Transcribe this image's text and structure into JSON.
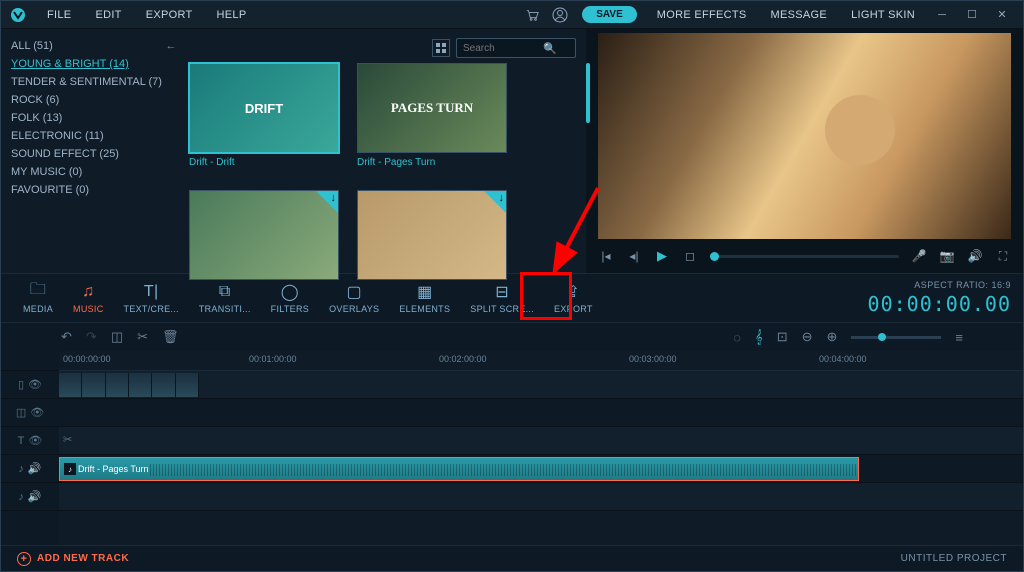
{
  "menubar": {
    "items": [
      "FILE",
      "EDIT",
      "EXPORT",
      "HELP"
    ],
    "save": "SAVE",
    "right_items": [
      "MORE EFFECTS",
      "MESSAGE",
      "LIGHT SKIN"
    ]
  },
  "categories": {
    "items": [
      {
        "label": "ALL (51)",
        "selected": false
      },
      {
        "label": "YOUNG & BRIGHT (14)",
        "selected": true
      },
      {
        "label": "TENDER & SENTIMENTAL (7)",
        "selected": false
      },
      {
        "label": "ROCK (6)",
        "selected": false
      },
      {
        "label": "FOLK (13)",
        "selected": false
      },
      {
        "label": "ELECTRONIC (11)",
        "selected": false
      },
      {
        "label": "SOUND EFFECT (25)",
        "selected": false
      },
      {
        "label": "MY MUSIC (0)",
        "selected": false
      },
      {
        "label": "FAVOURITE (0)",
        "selected": false
      }
    ]
  },
  "search": {
    "placeholder": "Search"
  },
  "thumbs": [
    {
      "title": "DRIFT",
      "label": "Drift - Drift",
      "selected": true,
      "download": false
    },
    {
      "title": "PAGES TURN",
      "label": "Drift - Pages Turn",
      "selected": false,
      "download": false
    },
    {
      "title": "",
      "label": "",
      "selected": false,
      "download": true
    },
    {
      "title": "",
      "label": "",
      "selected": false,
      "download": true
    }
  ],
  "tooltabs": [
    {
      "id": "media",
      "label": "MEDIA",
      "icon": "folder"
    },
    {
      "id": "music",
      "label": "MUSIC",
      "icon": "music",
      "active": true
    },
    {
      "id": "text",
      "label": "TEXT/CRE...",
      "icon": "text"
    },
    {
      "id": "transitions",
      "label": "TRANSITI...",
      "icon": "transition"
    },
    {
      "id": "filters",
      "label": "FILTERS",
      "icon": "filters"
    },
    {
      "id": "overlays",
      "label": "OVERLAYS",
      "icon": "overlay"
    },
    {
      "id": "elements",
      "label": "ELEMENTS",
      "icon": "elements"
    },
    {
      "id": "split",
      "label": "SPLIT SCRE...",
      "icon": "split"
    },
    {
      "id": "export",
      "label": "EXPORT",
      "icon": "export"
    }
  ],
  "aspect": {
    "label": "ASPECT RATIO: 16:9",
    "timecode": "00:00:00.00"
  },
  "ruler": [
    "00:00:00:00",
    "00:01:00:00",
    "00:02:00:00",
    "00:03:00:00",
    "00:04:00:00"
  ],
  "audio_clip": {
    "label": "Drift - Pages Turn"
  },
  "footer": {
    "add_track": "ADD NEW TRACK",
    "project": "UNTITLED PROJECT"
  }
}
